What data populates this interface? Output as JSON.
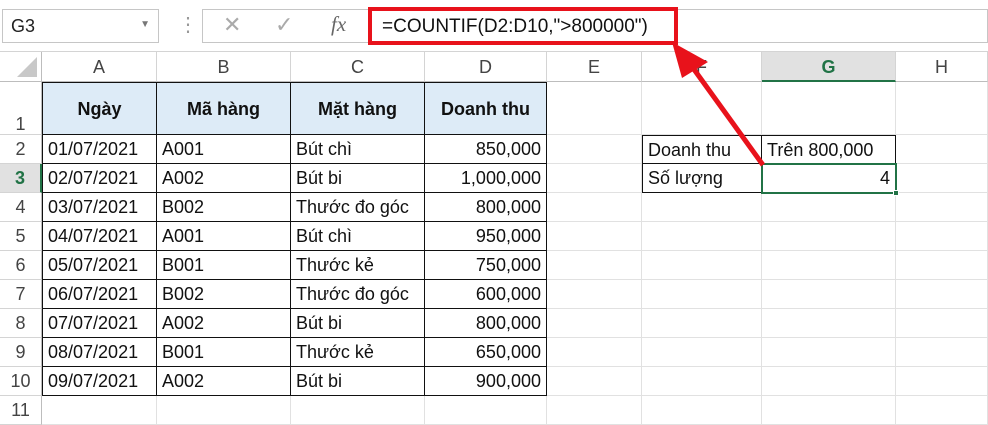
{
  "name_box": "G3",
  "formula_bar": {
    "cancel_icon": "✕",
    "enter_icon": "✓",
    "fx_label": "fx",
    "formula": "=COUNTIF(D2:D10,\">800000\")"
  },
  "columns": [
    "A",
    "B",
    "C",
    "D",
    "E",
    "F",
    "G",
    "H"
  ],
  "selected_column": "G",
  "rows": [
    "1",
    "2",
    "3",
    "4",
    "5",
    "6",
    "7",
    "8",
    "9",
    "10",
    "11"
  ],
  "selected_row": "3",
  "table": {
    "headers": [
      "Ngày",
      "Mã hàng",
      "Mặt hàng",
      "Doanh thu"
    ],
    "rows": [
      [
        "01/07/2021",
        "A001",
        "Bút chì",
        "850,000"
      ],
      [
        "02/07/2021",
        "A002",
        "Bút bi",
        "1,000,000"
      ],
      [
        "03/07/2021",
        "B002",
        "Thước đo góc",
        "800,000"
      ],
      [
        "04/07/2021",
        "A001",
        "Bút chì",
        "950,000"
      ],
      [
        "05/07/2021",
        "B001",
        "Thước kẻ",
        "750,000"
      ],
      [
        "06/07/2021",
        "B002",
        "Thước đo góc",
        "600,000"
      ],
      [
        "07/07/2021",
        "A002",
        "Bút bi",
        "800,000"
      ],
      [
        "08/07/2021",
        "B001",
        "Thước kẻ",
        "650,000"
      ],
      [
        "09/07/2021",
        "A002",
        "Bút bi",
        "900,000"
      ]
    ]
  },
  "summary": {
    "label1": "Doanh thu",
    "value1": "Trên 800,000",
    "label2": "Số lượng",
    "value2": "4"
  },
  "colors": {
    "annotation": "#e8121b",
    "selection": "#217346",
    "header_fill": "#ddebf7"
  }
}
